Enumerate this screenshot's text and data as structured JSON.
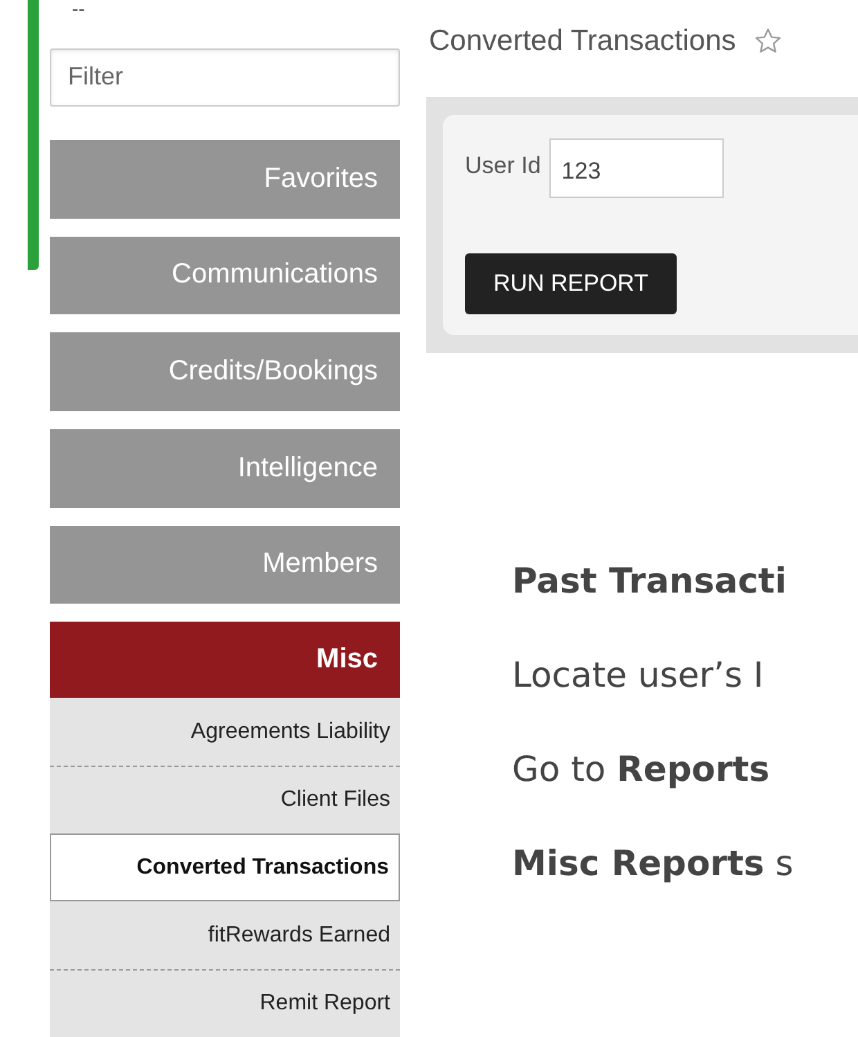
{
  "top_mark": "--",
  "sidebar": {
    "filter": {
      "placeholder": "Filter"
    },
    "sections": [
      {
        "label": "Favorites",
        "selected": false
      },
      {
        "label": "Communications",
        "selected": false
      },
      {
        "label": "Credits/Bookings",
        "selected": false
      },
      {
        "label": "Intelligence",
        "selected": false
      },
      {
        "label": "Members",
        "selected": false
      },
      {
        "label": "Misc",
        "selected": true,
        "children": [
          {
            "label": "Agreements Liability",
            "selected": false
          },
          {
            "label": "Client Files",
            "selected": false
          },
          {
            "label": "Converted Transactions",
            "selected": true
          },
          {
            "label": "fitRewards Earned",
            "selected": false
          },
          {
            "label": "Remit Report",
            "selected": false
          }
        ]
      }
    ]
  },
  "report": {
    "title": "Converted Transactions",
    "favorite": false,
    "fields": [
      {
        "label": "User Id",
        "value": "123"
      }
    ],
    "button": "RUN REPORT"
  },
  "help": [
    {
      "text": "**Past Transacti**"
    },
    {
      "text": "Locate user’s I"
    },
    {
      "text": "Go to **Reports**"
    },
    {
      "text": "**Misc Reports** s"
    }
  ]
}
